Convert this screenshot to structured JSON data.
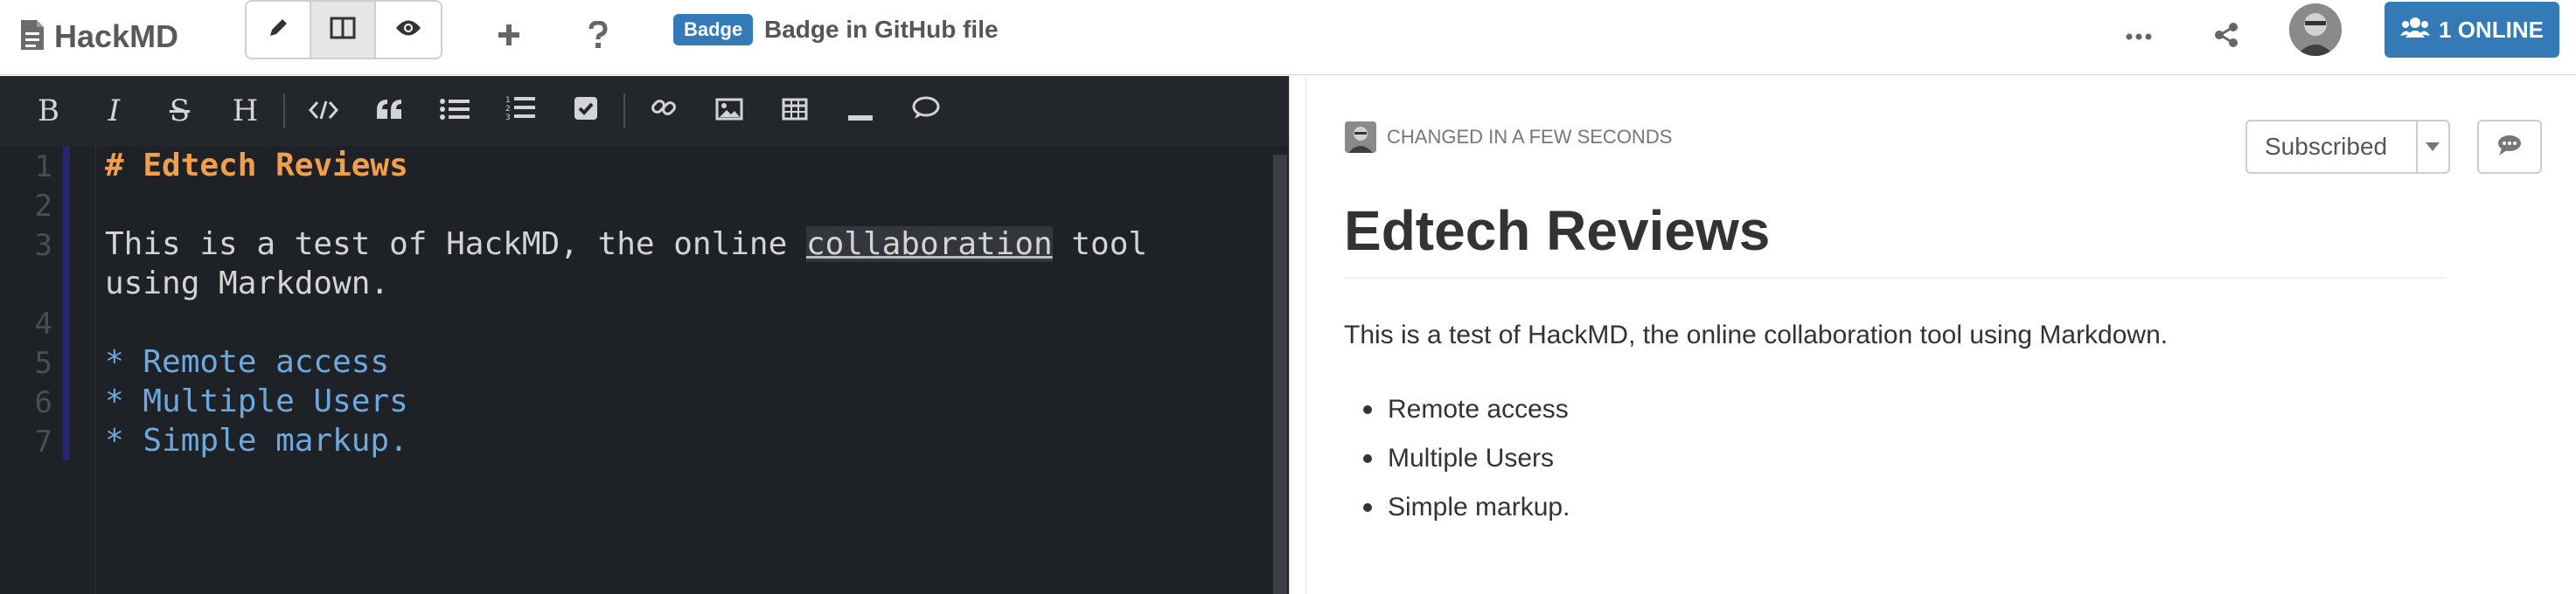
{
  "app": {
    "brand": "HackMD",
    "badge": "Badge",
    "document_title": "Badge in GitHub file",
    "online_label": "1 ONLINE"
  },
  "toolbar": {
    "bold": "B",
    "italic": "I",
    "strikethrough": "S",
    "heading": "H"
  },
  "editor": {
    "line_numbers": [
      "1",
      "2",
      "3",
      "",
      "4",
      "5",
      "6",
      "7"
    ],
    "lines": [
      {
        "text": "# Edtech Reviews",
        "kind": "heading"
      },
      {
        "text": "",
        "kind": "plain"
      },
      {
        "prefix": "This is a test of HackMD, the online ",
        "highlight": "collaboration",
        "suffix": " tool",
        "kind": "plain"
      },
      {
        "text": "using Markdown.",
        "kind": "plain"
      },
      {
        "text": "",
        "kind": "plain"
      },
      {
        "text": "* Remote access",
        "kind": "list"
      },
      {
        "text": "* Multiple Users",
        "kind": "list"
      },
      {
        "text": "* Simple markup.",
        "kind": "list"
      }
    ]
  },
  "preview": {
    "changed_text": "CHANGED IN A FEW SECONDS",
    "subscribed_label": "Subscribed",
    "title": "Edtech Reviews",
    "paragraph": "This is a test of HackMD, the online collaboration tool using Markdown.",
    "list_items": [
      "Remote access",
      "Multiple Users",
      "Simple markup."
    ]
  },
  "colors": {
    "accent": "#337ab7",
    "editor_bg": "#1e2125",
    "heading_orange": "#f29f4b",
    "list_blue": "#6fa8dc"
  }
}
